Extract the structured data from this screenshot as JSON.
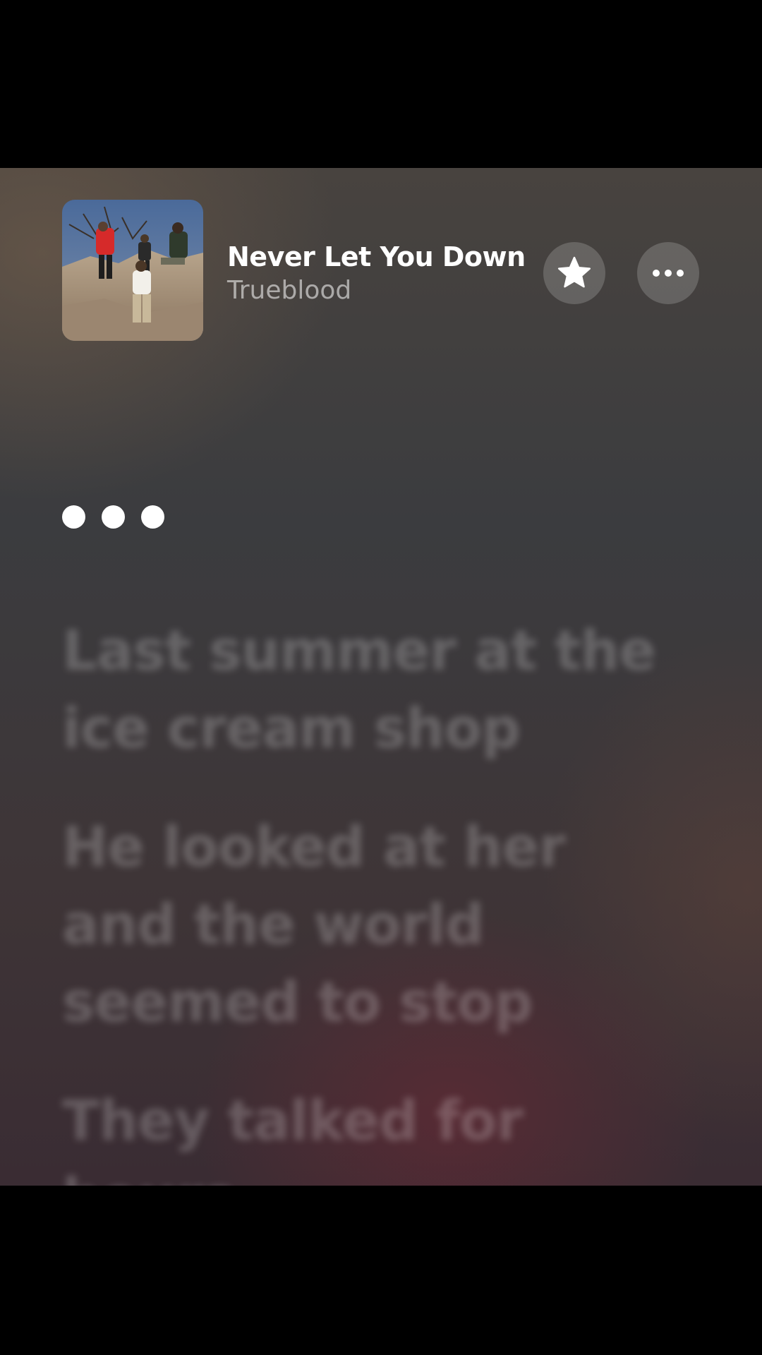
{
  "now_playing": {
    "title": "Never Let You Down",
    "artist": "Trueblood",
    "favorite_icon": "star-icon",
    "more_icon": "ellipsis-icon"
  },
  "lyrics": {
    "lines": [
      "Last summer at the ice cream shop",
      "He looked at her and the world seemed to stop",
      "They talked for hours"
    ]
  },
  "colors": {
    "text_primary": "#ffffff",
    "text_secondary": "rgba(255,255,255,0.55)",
    "button_bg": "rgba(255,255,255,0.18)"
  }
}
